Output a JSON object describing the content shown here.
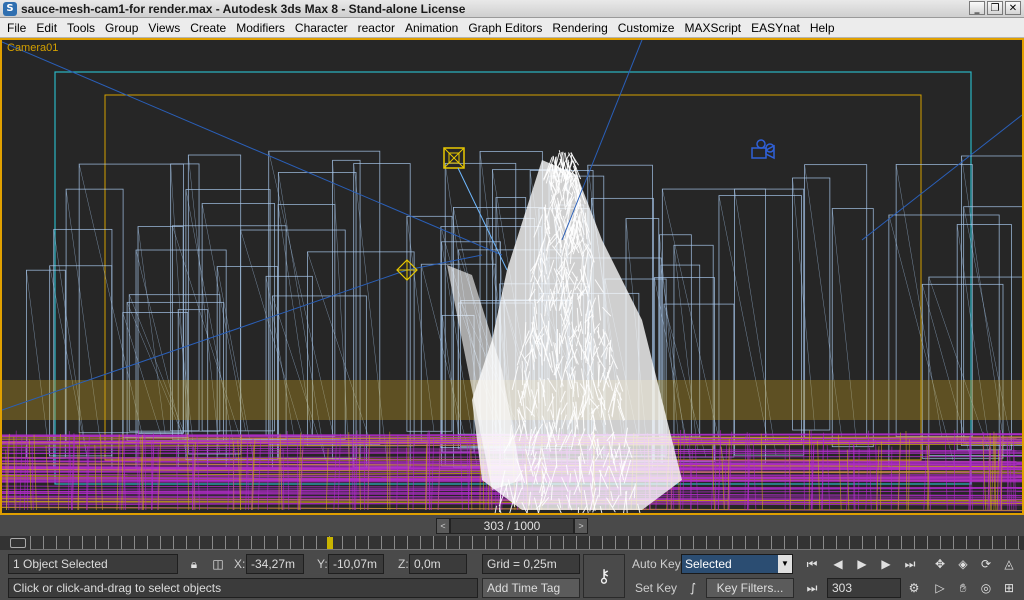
{
  "window": {
    "title": "sauce-mesh-cam1-for render.max - Autodesk 3ds Max 8  - Stand-alone License",
    "minimize": "_",
    "restore": "❐",
    "close": "✕"
  },
  "menu": [
    "File",
    "Edit",
    "Tools",
    "Group",
    "Views",
    "Create",
    "Modifiers",
    "Character",
    "reactor",
    "Animation",
    "Graph Editors",
    "Rendering",
    "Customize",
    "MAXScript",
    "EASYnat",
    "Help"
  ],
  "viewport": {
    "label": "Camera01",
    "colors": {
      "border": "#e0a000",
      "safe_frame": "#2bb5c4",
      "title_safe": "#d4a000",
      "buildings": "#a8c8ec",
      "ground": "#b02cc8",
      "mesh": "#ffffff"
    }
  },
  "timeline": {
    "frame_display": "303 / 1000",
    "prev": "<",
    "next": ">",
    "current_fraction": 0.303
  },
  "status": {
    "selection": "1 Object Selected",
    "prompt": "Click or click-and-drag to select objects",
    "x_label": "X:",
    "x_value": "-34,27m",
    "y_label": "Y:",
    "y_value": "-10,07m",
    "z_label": "Z:",
    "z_value": "0,0m",
    "grid": "Grid = 0,25m",
    "add_time_tag": "Add Time Tag",
    "auto_key": "Auto Key",
    "set_key": "Set Key",
    "selected_dropdown": "Selected",
    "key_filters": "Key Filters...",
    "current_frame": "303"
  }
}
